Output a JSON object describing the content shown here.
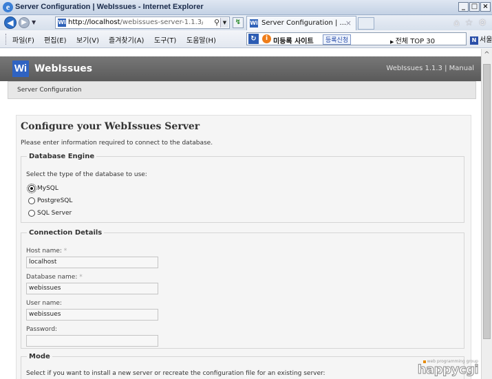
{
  "window": {
    "title": "Server Configuration | WebIssues - Internet Explorer",
    "buttons": [
      "_",
      "□",
      "×"
    ]
  },
  "browser": {
    "address": {
      "host": "http://localhost",
      "path": "/webissues-server-1.1.3/admin"
    },
    "tab": {
      "label": "Server Configuration | ...",
      "close": "×"
    },
    "menus": [
      "파일(F)",
      "편집(E)",
      "보기(V)",
      "즐겨찾기(A)",
      "도구(T)",
      "도움말(H)"
    ],
    "toolbar": {
      "site": "미등록 사이트",
      "register": "등록신청",
      "top": "전체 TOP 30",
      "city": "서울"
    },
    "icons": [
      "home-icon",
      "star-icon",
      "gear-icon"
    ]
  },
  "app": {
    "logo_text": "Wi",
    "name": "WebIssues",
    "version": "WebIssues 1.1.3",
    "separator": "|",
    "manual": "Manual",
    "breadcrumb": "Server Configuration"
  },
  "page": {
    "title": "Configure your WebIssues Server",
    "intro": "Please enter information required to connect to the database.",
    "engine": {
      "legend": "Database Engine",
      "hint": "Select the type of the database to use:",
      "options": [
        {
          "label": "MySQL",
          "checked": true
        },
        {
          "label": "PostgreSQL",
          "checked": false
        },
        {
          "label": "SQL Server",
          "checked": false
        }
      ]
    },
    "connection": {
      "legend": "Connection Details",
      "fields": [
        {
          "label": "Host name:",
          "required": "*",
          "value": "localhost"
        },
        {
          "label": "Database name:",
          "required": "*",
          "value": "webissues"
        },
        {
          "label": "User name:",
          "required": "",
          "value": "webissues"
        },
        {
          "label": "Password:",
          "required": "",
          "value": ""
        }
      ]
    },
    "mode": {
      "legend": "Mode",
      "hint": "Select if you want to install a new server or recreate the configuration file for an existing server:"
    }
  },
  "watermark": {
    "tag": "web programming group",
    "brand": "happycgi"
  }
}
